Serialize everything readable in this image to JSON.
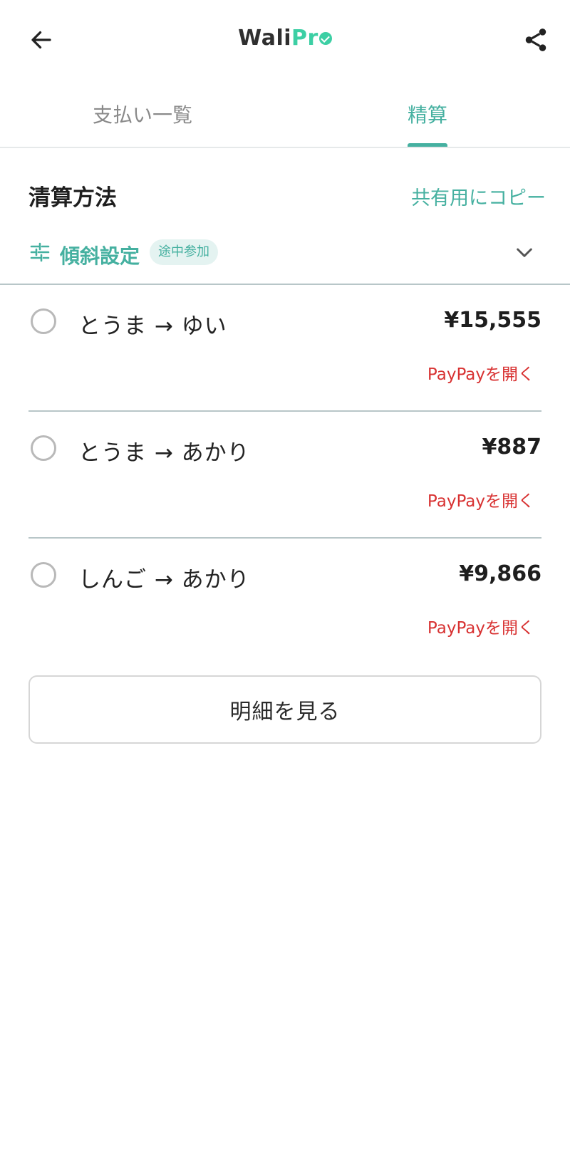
{
  "app": {
    "logo_part1": "Wali",
    "logo_part2": "Pr"
  },
  "appbar": {
    "back_icon": "arrow-left-icon",
    "share_icon": "share-icon"
  },
  "tabs": [
    {
      "label": "支払い一覧",
      "active": false
    },
    {
      "label": "精算",
      "active": true
    }
  ],
  "section": {
    "title": "清算方法",
    "copy_label": "共有用にコピー"
  },
  "slope": {
    "label": "傾斜設定",
    "badge": "途中参加",
    "icon": "sliders-icon",
    "chevron_icon": "chevron-down-icon"
  },
  "transfers": [
    {
      "from_to": "とうま → ゆい",
      "amount": "¥15,555",
      "link": "PayPayを開く",
      "checked": false
    },
    {
      "from_to": "とうま → あかり",
      "amount": "¥887",
      "link": "PayPayを開く",
      "checked": false
    },
    {
      "from_to": "しんご → あかり",
      "amount": "¥9,866",
      "link": "PayPayを開く",
      "checked": false
    }
  ],
  "detail_button": "明細を見る",
  "colors": {
    "accent": "#45b0a0",
    "logo_green": "#3ccfa4",
    "paypay_red": "#d83232",
    "divider": "#b8c6c8"
  }
}
